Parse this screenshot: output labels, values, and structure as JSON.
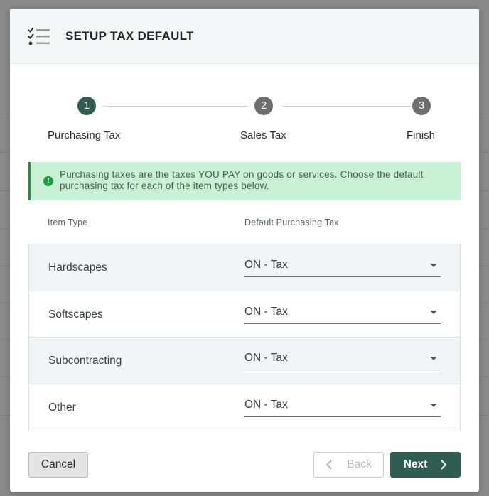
{
  "dialog": {
    "title": "SETUP TAX DEFAULT",
    "header_icon": "checklist-icon"
  },
  "stepper": {
    "steps": [
      {
        "number": "1",
        "label": "Purchasing Tax",
        "state": "active"
      },
      {
        "number": "2",
        "label": "Sales Tax",
        "state": "inactive"
      },
      {
        "number": "3",
        "label": "Finish",
        "state": "inactive"
      }
    ]
  },
  "alert": {
    "icon": "info-icon",
    "glyph": "!",
    "text": "Purchasing taxes are the taxes YOU PAY on goods or services. Choose the default purchasing tax for each of the item types below."
  },
  "table": {
    "headers": {
      "item_type": "Item Type",
      "default_tax": "Default Purchasing Tax"
    },
    "rows": [
      {
        "item_type": "Hardscapes",
        "tax": "ON - Tax"
      },
      {
        "item_type": "Softscapes",
        "tax": "ON - Tax"
      },
      {
        "item_type": "Subcontracting",
        "tax": "ON - Tax"
      },
      {
        "item_type": "Other",
        "tax": "ON - Tax"
      }
    ]
  },
  "footer": {
    "cancel_label": "Cancel",
    "back_label": "Back",
    "next_label": "Next"
  },
  "colors": {
    "primary": "#2f5d52",
    "alert_bg": "#c9f1d5",
    "alert_border": "#2f8a3d"
  }
}
